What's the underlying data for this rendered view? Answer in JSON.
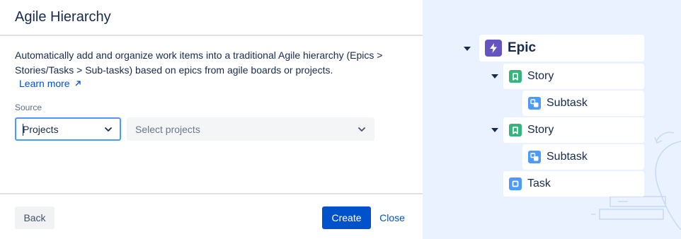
{
  "dialog": {
    "title": "Agile Hierarchy",
    "description": "Automatically add and organize work items into a traditional Agile hierarchy (Epics > Stories/Tasks > Sub-tasks) based on epics from agile boards or projects.",
    "learn_more": "Learn more",
    "source_label": "Source",
    "source_value": "Projects",
    "projects_placeholder": "Select projects",
    "back_label": "Back",
    "create_label": "Create",
    "close_label": "Close"
  },
  "hierarchy": {
    "epic": "Epic",
    "story_1": "Story",
    "subtask_1": "Subtask",
    "story_2": "Story",
    "subtask_2": "Subtask",
    "task": "Task"
  },
  "colors": {
    "primary": "#0052cc",
    "epic": "#6554c0",
    "story": "#36b37e",
    "subtask": "#4c9aff",
    "panel": "#e9f2fe"
  },
  "icons": [
    "external-link-icon",
    "chevron-down-icon",
    "epic-icon",
    "story-icon",
    "subtask-icon",
    "task-icon",
    "collapse-triangle-icon"
  ]
}
